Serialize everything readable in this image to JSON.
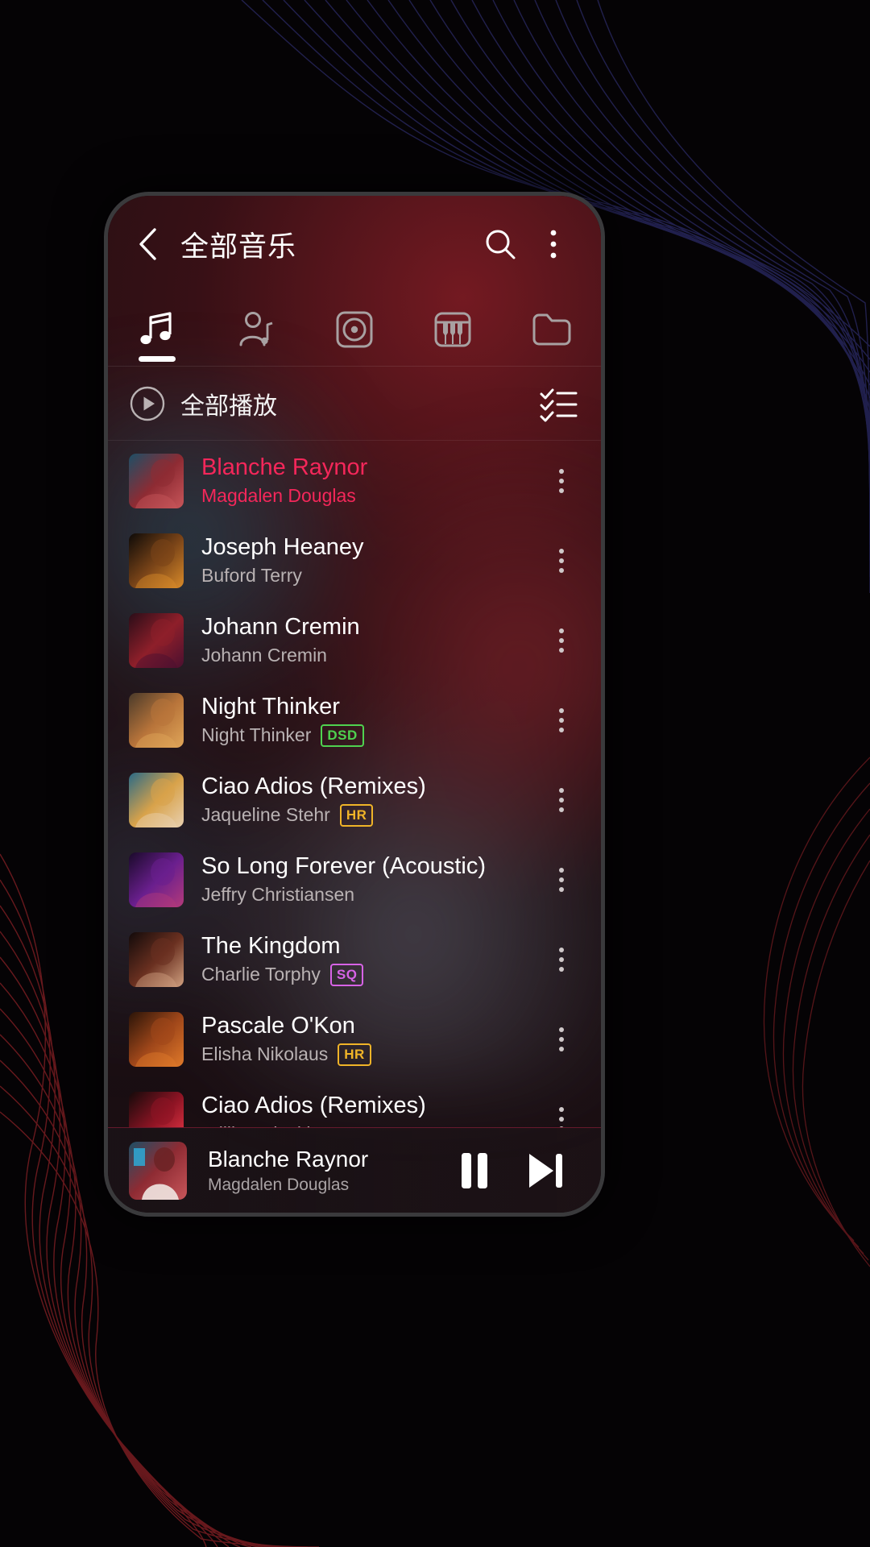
{
  "app": {
    "header": {
      "back_icon": "chevron-left-icon",
      "title": "全部音乐",
      "search_icon": "search-icon",
      "overflow_icon": "more-vertical-icon"
    },
    "tabs": [
      {
        "key": "songs",
        "icon": "music-note-icon",
        "active": true
      },
      {
        "key": "artists",
        "icon": "artist-icon",
        "active": false
      },
      {
        "key": "albums",
        "icon": "album-disc-icon",
        "active": false
      },
      {
        "key": "genres",
        "icon": "piano-keys-icon",
        "active": false
      },
      {
        "key": "folders",
        "icon": "folder-icon",
        "active": false
      }
    ],
    "play_all": {
      "icon": "play-circle-icon",
      "label": "全部播放",
      "select_icon": "select-all-list-icon"
    },
    "tracks": [
      {
        "title": "Blanche Raynor",
        "artist": "Magdalen Douglas",
        "badge": "",
        "playing": true,
        "art": "portrait-neon-red"
      },
      {
        "title": "Joseph Heaney",
        "artist": "Buford Terry",
        "badge": "",
        "playing": false,
        "art": "dark-butterfly"
      },
      {
        "title": "Johann Cremin",
        "artist": "Johann Cremin",
        "badge": "",
        "playing": false,
        "art": "red-portrait"
      },
      {
        "title": "Night Thinker",
        "artist": "Night Thinker",
        "badge": "DSD",
        "playing": false,
        "art": "band-stage"
      },
      {
        "title": "Ciao Adios (Remixes)",
        "artist": "Jaqueline Stehr",
        "badge": "HR",
        "playing": false,
        "art": "yellow-suit"
      },
      {
        "title": "So Long Forever (Acoustic)",
        "artist": "Jeffry Christiansen",
        "badge": "",
        "playing": false,
        "art": "purple-singer"
      },
      {
        "title": "The Kingdom",
        "artist": "Charlie Torphy",
        "badge": "SQ",
        "playing": false,
        "art": "woman-glasses"
      },
      {
        "title": "Pascale O'Kon",
        "artist": "Elisha Nikolaus",
        "badge": "HR",
        "playing": false,
        "art": "orange-chevrons"
      },
      {
        "title": "Ciao Adios (Remixes)",
        "artist": "Willis Osinski",
        "badge": "",
        "playing": false,
        "art": "neon-sign"
      }
    ],
    "mini_player": {
      "title": "Blanche Raynor",
      "artist": "Magdalen Douglas",
      "pause_icon": "pause-icon",
      "next_icon": "skip-next-icon",
      "art": "portrait-neon-red"
    },
    "colors": {
      "accent": "#f4275a",
      "badge_dsd": "#4fd24f",
      "badge_hr": "#f0b428",
      "badge_sq": "#d763e6",
      "text_primary": "#ffffff",
      "text_secondary": "#b9b2b3"
    }
  }
}
